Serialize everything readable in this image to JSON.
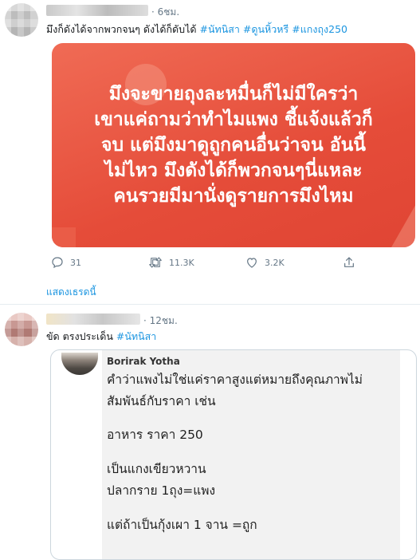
{
  "tweet1": {
    "time": "· 6ชม.",
    "text": "มึงก็ดังได้จากพวกจนๆ ดังได้ก็ดับได้ ",
    "hashtags": [
      "#นัทนิสา",
      "#ดูนหิ้วหรี",
      "#แกงถุง250"
    ],
    "image_text_lines": [
      "มึงจะขายถุงละหมื่นก็ไม่มีใครว่า",
      "เขาแค่ถามว่าทำไมแพง ชี้แจ้งแล้วก็",
      "จบ แต่มึงมาดูถูกคนอื่นว่าจน อันนี้",
      "ไม่ไหว มึงดังได้ก็พวกจนๆนี่แหละ",
      "คนรวยมีมานั่งดูรายการมึงไหม"
    ],
    "actions": {
      "reply_count": "31",
      "retweet_count": "11.3K",
      "like_count": "3.2K"
    },
    "show_thread": "แสดงเธรดนี้"
  },
  "tweet2": {
    "time": "· 12ชม.",
    "text": "ขัด ตรงประเด็น ",
    "hashtag": "#นัทนิสา",
    "quote": {
      "author": "Borirak Yotha",
      "lines": [
        "คำว่าแพงไม่ใช่แค่ราคาสูงแต่หมายถึงคุณภาพไม่",
        "สัมพันธ์กับราคา เช่น",
        "อาหาร ราคา 250",
        "เป็นแกงเขียวหวาน",
        "ปลากราย 1ถุง=แพง",
        "แต่ถ้าเป็นกุ้งเผา 1 จาน =ถูก"
      ]
    }
  },
  "colors": {
    "link": "#1b95e0",
    "muted": "#657786",
    "card_red": "#e54c39"
  },
  "icons": [
    "reply-icon",
    "retweet-icon",
    "like-icon",
    "share-icon"
  ]
}
